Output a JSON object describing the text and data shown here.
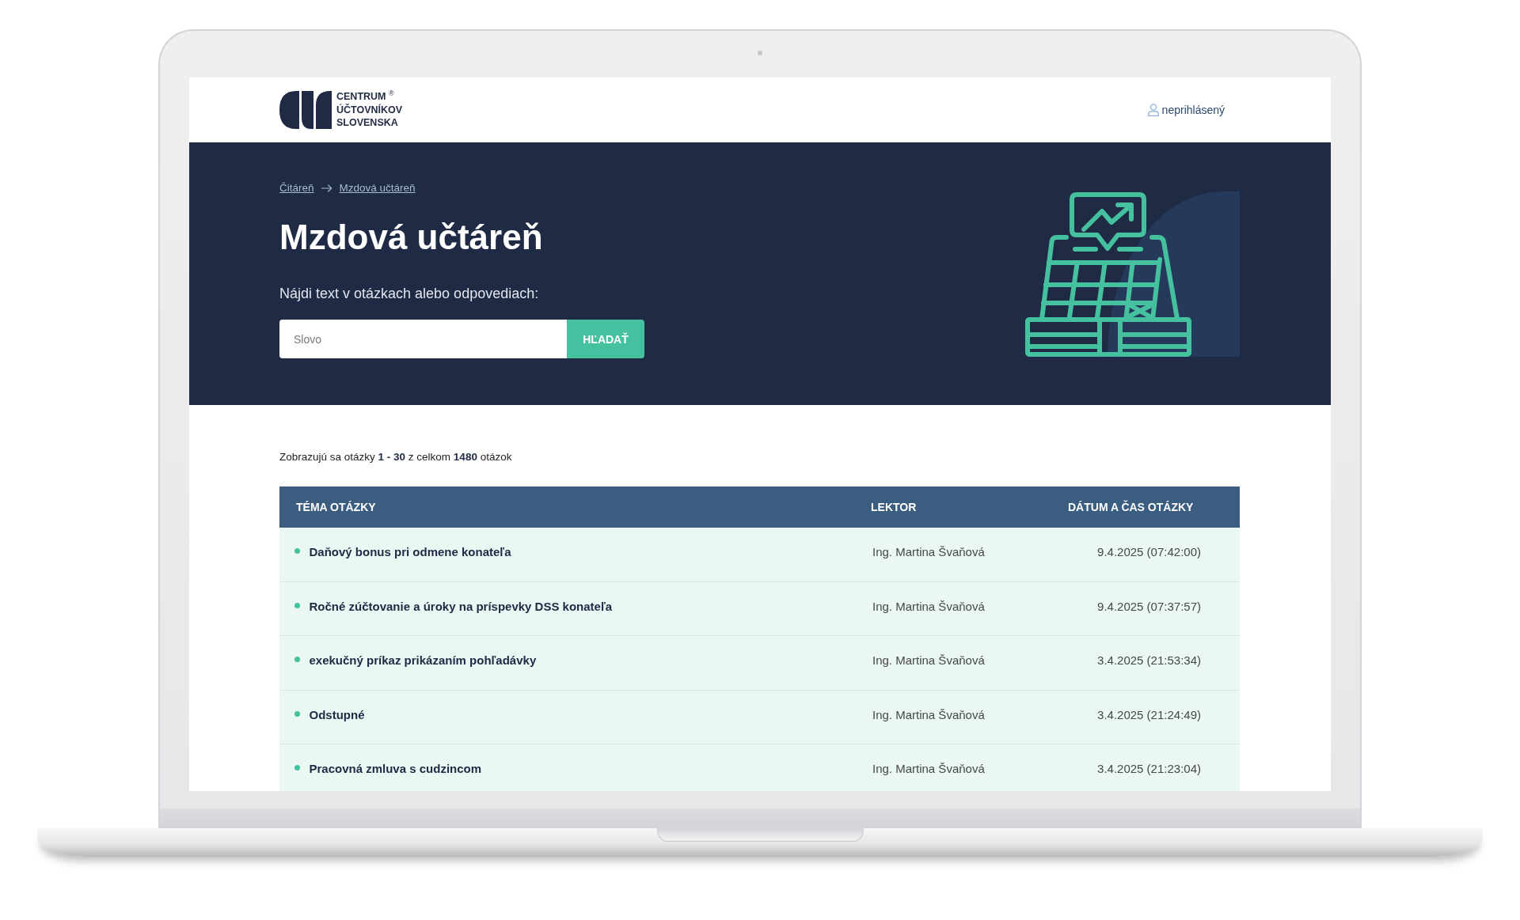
{
  "header": {
    "brand_lines": [
      "CENTRUM $^{®}$",
      "ÚČTOVNÍKOV",
      "SLOVENSKA"
    ],
    "user_link": "neprihlásený"
  },
  "hero": {
    "breadcrumb": [
      "Čitáreň",
      "Mzdová učtáreň"
    ],
    "title": "Mzdová učtáreň",
    "search": {
      "label": "Nájdi text v otázkach alebo odpovediach:",
      "placeholder": "Slovo",
      "button": "HĽADAŤ"
    }
  },
  "results": {
    "summary": "Zobrazujú sa otázky **1 - 30** z celkom **1480** otázok"
  },
  "table": {
    "columns": [
      "TÉMA OTÁZKY",
      "LEKTOR",
      "DÁTUM A ČAS OTÁZKY"
    ],
    "rows": [
      {
        "topic": "Daňový bonus pri odmene konateľa",
        "lektor": "Ing. Martina Švaňová",
        "date": "9.4.2025 (07:42:00)"
      },
      {
        "topic": "Ročné zúčtovanie a úroky na príspevky DSS konateľa",
        "lektor": "Ing. Martina Švaňová",
        "date": "9.4.2025 (07:37:57)"
      },
      {
        "topic": "exekučný príkaz prikázaním pohľadávky",
        "lektor": "Ing. Martina Švaňová",
        "date": "3.4.2025 (21:53:34)"
      },
      {
        "topic": "Odstupné",
        "lektor": "Ing. Martina Švaňová",
        "date": "3.4.2025 (21:24:49)"
      },
      {
        "topic": "Pracovná zmluva s cudzincom",
        "lektor": "Ing. Martina Švaňová",
        "date": "3.4.2025 (21:23:04)"
      }
    ]
  }
}
